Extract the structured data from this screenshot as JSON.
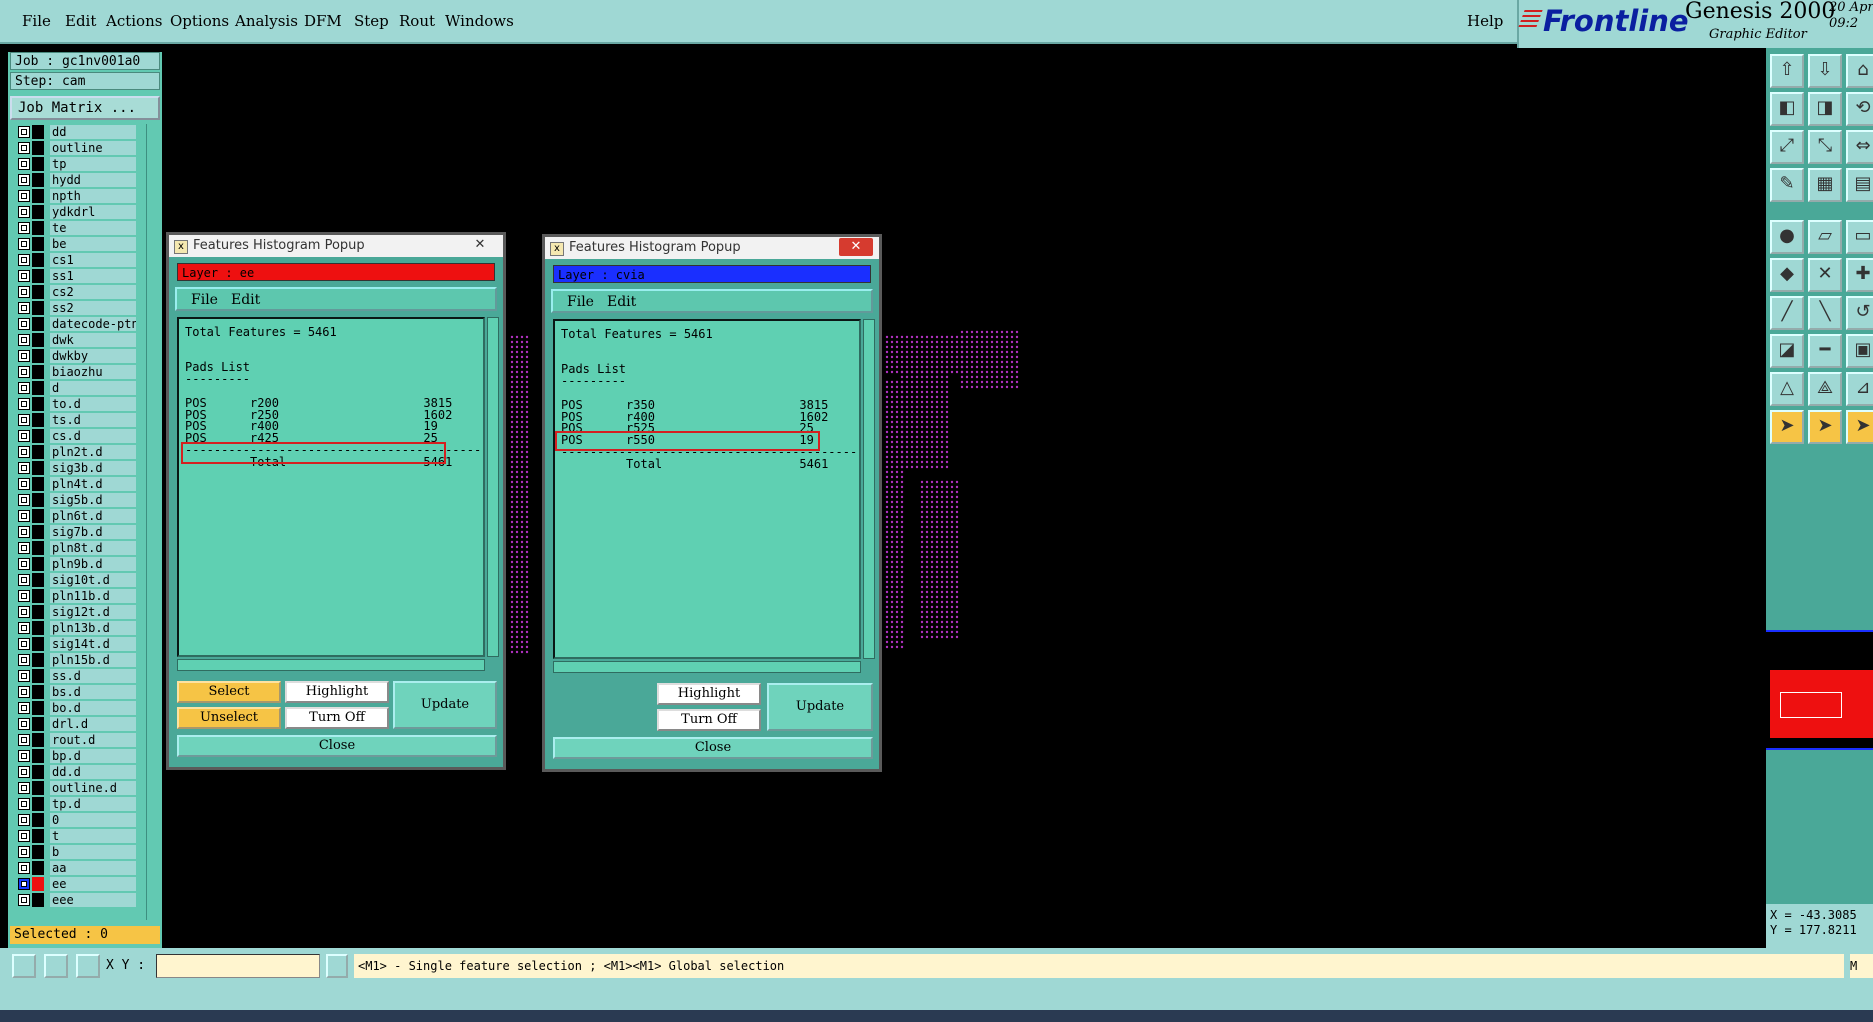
{
  "menu": [
    "File",
    "Edit",
    "Actions",
    "Options",
    "Analysis",
    "DFM",
    "Step",
    "Rout",
    "Windows"
  ],
  "help": "Help",
  "brand": {
    "logo": "Frontline",
    "product": "Genesis 2000",
    "sub": "Graphic Editor",
    "date": "20 Apr",
    "time": "09:2"
  },
  "job": {
    "job_label": "Job : gc1nv001a0",
    "step_label": "Step: cam",
    "matrix_button": "Job Matrix ..."
  },
  "layers": [
    "dd",
    "outline",
    "tp",
    "hydd",
    "npth",
    "ydkdrl",
    "te",
    "be",
    "cs1",
    "ss1",
    "cs2",
    "ss2",
    "datecode-ptn",
    "dwk",
    "dwkby",
    "biaozhu",
    "d",
    "to.d",
    "ts.d",
    "cs.d",
    "pln2t.d",
    "sig3b.d",
    "pln4t.d",
    "sig5b.d",
    "pln6t.d",
    "sig7b.d",
    "pln8t.d",
    "pln9b.d",
    "sig10t.d",
    "pln11b.d",
    "sig12t.d",
    "pln13b.d",
    "sig14t.d",
    "pln15b.d",
    "ss.d",
    "bs.d",
    "bo.d",
    "drl.d",
    "rout.d",
    "bp.d",
    "dd.d",
    "outline.d",
    "tp.d",
    "0",
    "t",
    "b",
    "aa",
    "ee",
    "eee"
  ],
  "selected": "Selected : 0",
  "popup1": {
    "title": "Features Histogram Popup",
    "layer": "Layer :  ee",
    "layer_color": "#ee1010",
    "menu": [
      "File",
      "Edit"
    ],
    "lines": [
      "Total Features = 5461",
      "",
      "",
      "Pads List",
      "---------",
      "",
      "POS      r200                    3815",
      "POS      r250                    1602",
      "POS      r400                    19",
      "POS      r425                    25",
      "-----------------------------------------",
      "         Total                   5461"
    ],
    "buttons": {
      "select": "Select",
      "highlight": "Highlight",
      "update": "Update",
      "unselect": "Unselect",
      "turnoff": "Turn Off",
      "close": "Close"
    }
  },
  "popup2": {
    "title": "Features Histogram Popup",
    "layer": "Layer :  cvia",
    "layer_color": "#1a2fff",
    "menu": [
      "File",
      "Edit"
    ],
    "lines": [
      "Total Features = 5461",
      "",
      "",
      "Pads List",
      "---------",
      "",
      "POS      r350                    3815",
      "POS      r400                    1602",
      "POS      r525                    25",
      "POS      r550                    19",
      "-----------------------------------------",
      "         Total                   5461"
    ],
    "buttons": {
      "highlight": "Highlight",
      "update": "Update",
      "turnoff": "Turn Off",
      "close": "Close"
    }
  },
  "coords": {
    "x": "X = -43.3085",
    "y": "Y = 177.8211"
  },
  "bottom": {
    "xy_label": "X Y :",
    "message": "<M1> - Single feature selection ; <M1><M1> Global selection",
    "right": "M"
  }
}
